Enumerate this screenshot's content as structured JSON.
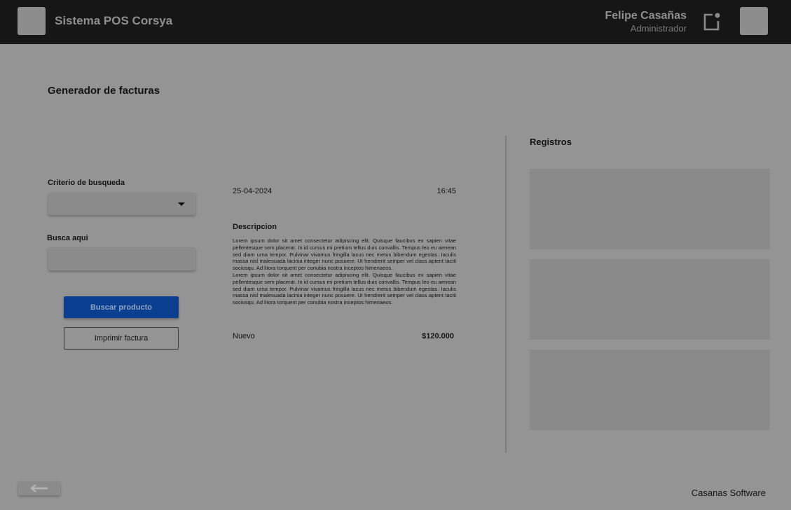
{
  "header": {
    "app_title": "Sistema POS Corsya",
    "user_name": "Felipe Casañas",
    "user_role": "Administrador",
    "icons": [
      "app-logo",
      "notification-icon",
      "user-avatar"
    ]
  },
  "page": {
    "title": "Generador de facturas"
  },
  "form": {
    "criteria_label": "Criterio de busqueda",
    "criteria_value": "",
    "search_label": "Busca aqui",
    "search_value": "",
    "search_placeholder": "",
    "search_button": "Buscar producto",
    "print_button": "Imprimir factura"
  },
  "invoice": {
    "date": "25-04-2024",
    "time": "16:45",
    "description_title": "Descripcion",
    "description_paragraphs": [
      "Lorem ipsum dolor sit amet consectetur adipiscing elit. Quisque faucibus ex sapien vitae pellentesque sem placerat. In id cursus mi pretium tellus duis convallis. Tempus leo eu aenean sed diam urna tempor. Pulvinar vivamus fringilla lacus nec metus bibendum egestas. Iaculis massa nisl malesuada lacinia integer nunc posuere. Ut hendrerit semper vel class aptent taciti sociosqu. Ad litora torquent per conubia nostra inceptos himenaeos.",
      "Lorem ipsum dolor sit amet consectetur adipiscing elit. Quisque faucibus ex sapien vitae pellentesque sem placerat. In id cursus mi pretium tellus duis convallis. Tempus leo eu aenean sed diam urna tempor. Pulvinar vivamus fringilla lacus nec metus bibendum egestas. Iaculis massa nisl malesuada lacinia integer nunc posuere. Ut hendrerit semper vel class aptent taciti sociosqu. Ad litora torquent per conubia nostra inceptos himenaeos."
    ],
    "status": "Nuevo",
    "price": "$120.000"
  },
  "records": {
    "title": "Registros",
    "items": [
      "",
      "",
      ""
    ]
  },
  "footer": {
    "back_icon": "arrow-left-icon",
    "brand": "Casanas Software"
  },
  "colors": {
    "header_bg": "#161616",
    "page_bg": "#949494",
    "primary_button": "#0a3e8f",
    "placeholder_box": "#8b8b8b"
  }
}
